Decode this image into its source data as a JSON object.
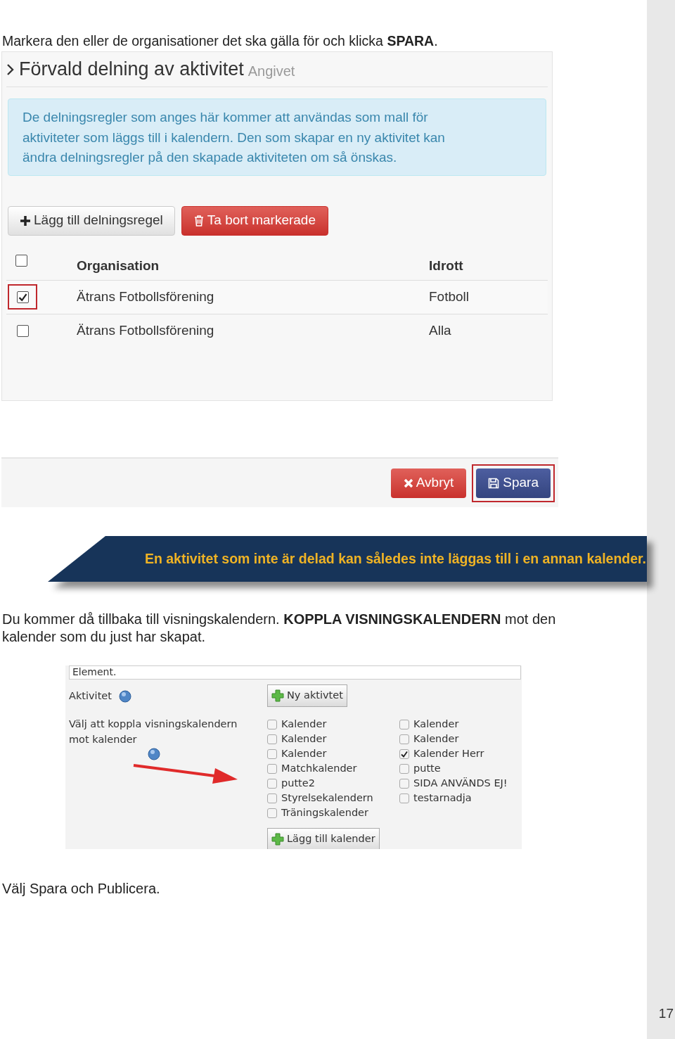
{
  "intro": "Markera den eller de organisationer det ska gälla för och klicka **SPARA**.",
  "sharing_panel": {
    "title": "Förvald delning av aktivitet",
    "status": "Angivet",
    "info": "De delningsregler som anges här kommer att användas som mall för aktiviteter som läggs till i kalendern. Den som skapar en ny aktivitet kan ändra delningsregler på den skapade aktiviteten om så önskas.",
    "buttons": [
      {
        "kind": "add",
        "label": "Lägg till delningsregel"
      },
      {
        "kind": "delete",
        "label": "Ta bort markerade"
      }
    ],
    "columns": [
      "Organisation",
      "Idrott"
    ],
    "header_checked": false,
    "rows": [
      {
        "organisation": "Ätrans Fotbollsförening",
        "sport": "Fotboll",
        "checked": true,
        "highlighted": true
      },
      {
        "organisation": "Ätrans Fotbollsförening",
        "sport": "Alla",
        "checked": false,
        "highlighted": false
      }
    ]
  },
  "form_actions": [
    {
      "kind": "cancel",
      "label": "Avbryt",
      "highlighted": false
    },
    {
      "kind": "save",
      "label": "Spara",
      "highlighted": true
    }
  ],
  "banner": "En aktivitet som inte är delad kan således inte läggas till i en annan kalender.",
  "paragraph": "Du kommer då tillbaka till visningskalendern. **KOPPLA VISNINGSKALENDERN** mot den kalender som du just har skapat.",
  "calendar_form": {
    "top_field": "Element.",
    "activity_label": "Aktivitet",
    "new_activity_button": "Ny aktivtet",
    "link_label": "Välj att koppla visningskalendern mot kalender",
    "calendar_columns": [
      [
        {
          "label": "Kalender",
          "checked": false
        },
        {
          "label": "Kalender",
          "checked": false
        },
        {
          "label": "Kalender",
          "checked": false
        },
        {
          "label": "Matchkalender",
          "checked": false
        },
        {
          "label": "putte2",
          "checked": false
        },
        {
          "label": "Styrelsekalendern",
          "checked": false
        },
        {
          "label": "Träningskalender",
          "checked": false
        }
      ],
      [
        {
          "label": "Kalender",
          "checked": false
        },
        {
          "label": "Kalender",
          "checked": false
        },
        {
          "label": "Kalender Herr",
          "checked": true
        },
        {
          "label": "putte",
          "checked": false
        },
        {
          "label": "SIDA ANVÄNDS EJ!",
          "checked": false
        },
        {
          "label": "testarnadja",
          "checked": false
        }
      ]
    ],
    "add_calendar_button": "Lägg till kalender"
  },
  "closing": "Välj Spara och Publicera.",
  "page_number": "17"
}
